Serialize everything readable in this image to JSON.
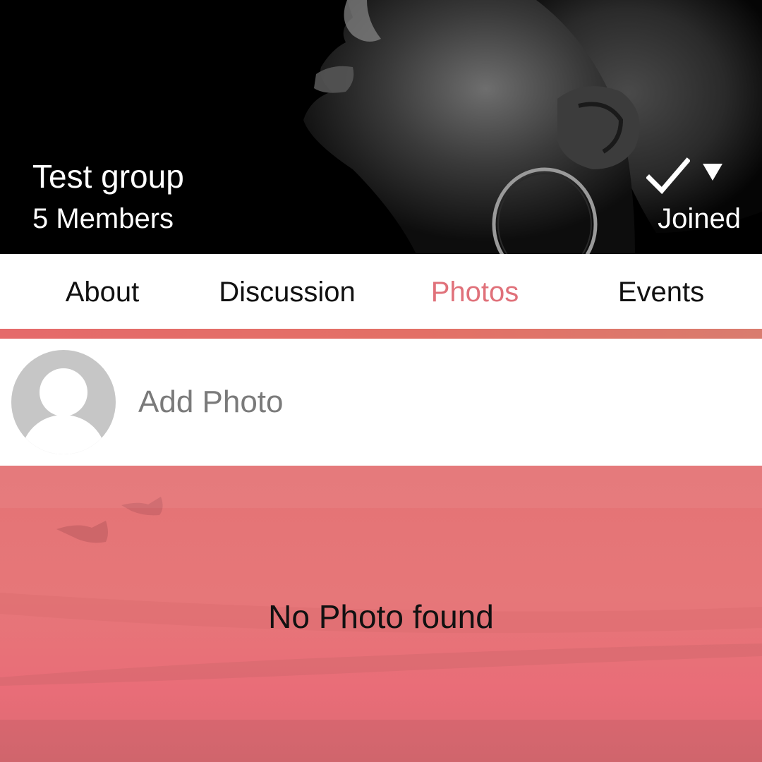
{
  "group": {
    "name": "Test group",
    "members": "5 Members",
    "join_status": "Joined"
  },
  "tabs": [
    {
      "label": "About",
      "active": false
    },
    {
      "label": "Discussion",
      "active": false
    },
    {
      "label": "Photos",
      "active": true
    },
    {
      "label": "Events",
      "active": false
    }
  ],
  "add_photo": {
    "label": "Add Photo",
    "avatar_icon": "default-avatar-icon"
  },
  "empty_state": {
    "message": "No Photo found"
  },
  "icons": {
    "join_check": "check-icon",
    "join_menu": "caret-down-icon"
  },
  "colors": {
    "accent": "#e0717a",
    "tab_indicator": "#e56a6a",
    "header_bg": "#000000",
    "empty_bg": "#e57779",
    "avatar_gray": "#c6c6c6",
    "add_label": "#7a7a7a"
  }
}
